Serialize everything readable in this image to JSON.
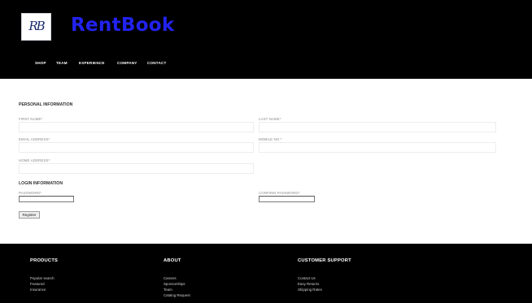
{
  "header": {
    "logo_text": "RB",
    "brand": "RentBook",
    "brand_color": "#2222ee",
    "background": "#000000",
    "nav": [
      "SHOP",
      "TEAM",
      "EXPERIENCE",
      "COMPANY",
      "CONTACT"
    ]
  },
  "form": {
    "personal_title": "PERSONAL INFORMATION",
    "first_name_label": "FIRST NAME*",
    "last_name_label": "LAST NAME*",
    "email_label": "EMAIL ADDRESS*",
    "mobile_label": "MOBILE NO.*",
    "home_address_label": "HOME ADDRESS*",
    "login_title": "LOGIN INFORMATION",
    "password_label": "PASSWORD*",
    "confirm_password_label": "CONFIRM PASSWORD*",
    "register_label": "Register"
  },
  "footer": {
    "background": "#000000",
    "columns": [
      {
        "heading": "PRODUCTS",
        "links": [
          "Popular search",
          "Featured",
          "Insurance"
        ]
      },
      {
        "heading": "ABOUT",
        "links": [
          "Careers",
          "Sponsorships",
          "Team",
          "Catalog Request"
        ]
      },
      {
        "heading": "CUSTOMER SUPPORT",
        "links": [
          "Contact Us",
          "Easy Returns",
          "Shipping Rates"
        ]
      }
    ]
  }
}
